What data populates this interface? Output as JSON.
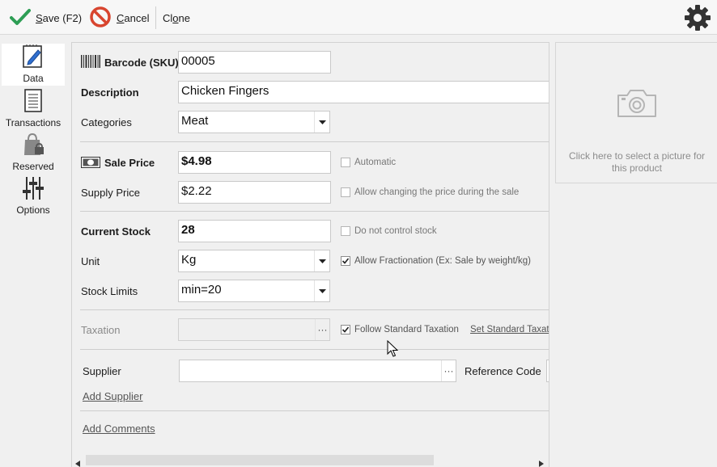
{
  "toolbar": {
    "save": {
      "text": "ave (F2)",
      "accel": "S"
    },
    "cancel": {
      "text": "ancel",
      "accel": "C"
    },
    "clone": {
      "pre": "Cl",
      "accel": "o",
      "post": "ne"
    }
  },
  "sidebar": {
    "items": [
      {
        "label": "Data",
        "icon": "pencil-document-icon",
        "active": true
      },
      {
        "label": "Transactions",
        "icon": "ledger-icon",
        "active": false
      },
      {
        "label": "Reserved",
        "icon": "locked-bag-icon",
        "active": false
      },
      {
        "label": "Options",
        "icon": "sliders-icon",
        "active": false
      }
    ]
  },
  "form": {
    "barcode": {
      "label": "Barcode (SKU)",
      "value": "00005"
    },
    "description": {
      "label": "Description",
      "value": "Chicken Fingers"
    },
    "categories": {
      "label": "Categories",
      "value": "Meat"
    },
    "sale_price": {
      "label": "Sale Price",
      "value": "$4.98",
      "checkbox": "Automatic",
      "checked": false
    },
    "supply_price": {
      "label": "Supply Price",
      "value": "$2.22",
      "checkbox": "Allow changing the price during the sale",
      "checked": false
    },
    "current_stock": {
      "label": "Current Stock",
      "value": "28",
      "checkbox": "Do not control stock",
      "checked": false
    },
    "unit": {
      "label": "Unit",
      "value": "Kg",
      "checkbox": "Allow Fractionation (Ex: Sale by weight/kg)",
      "checked": true
    },
    "stock_limits": {
      "label": "Stock Limits",
      "value": "min=20"
    },
    "taxation": {
      "label": "Taxation",
      "value": "",
      "checkbox": "Follow Standard Taxation",
      "checked": true,
      "link": "Set Standard Taxati"
    },
    "supplier": {
      "label": "Supplier",
      "value": "",
      "reference_label": "Reference Code",
      "add_link": "Add Supplier"
    },
    "comments": {
      "add_link": "Add Comments"
    }
  },
  "picture": {
    "hint": "Click here to select a picture for this product",
    "icon": "camera-icon"
  },
  "colors": {
    "save_check": "#2e9e55",
    "cancel_red": "#d8452f",
    "link_gray": "#555555"
  }
}
